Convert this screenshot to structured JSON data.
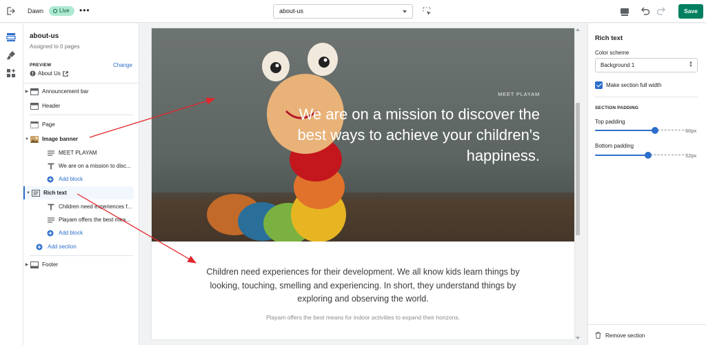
{
  "topbar": {
    "theme_name": "Dawn",
    "status_badge": "Live",
    "more_label": "•••",
    "page_select_value": "about-us",
    "save_label": "Save"
  },
  "left_panel": {
    "template_name": "about-us",
    "assigned": "Assigned to 0 pages",
    "preview_header": "PREVIEW",
    "change_link": "Change",
    "preview_page": "About Us",
    "sections": {
      "announcement_bar": "Announcement bar",
      "header": "Header",
      "page": "Page",
      "image_banner": "Image banner",
      "image_banner_blocks": [
        "MEET PLAYAM",
        "We are on a mission to disc..."
      ],
      "rich_text": "Rich text",
      "rich_text_blocks": [
        "Children need experiences f...",
        "Playam offers the best mea..."
      ],
      "add_block": "Add block",
      "add_section": "Add section",
      "footer": "Footer"
    }
  },
  "preview": {
    "banner_eyebrow": "MEET PLAYAM",
    "banner_headline": "We are on a mission to discover the best ways to achieve your children's happiness.",
    "rich_text_paragraph": "Children need experiences for their development. We all know kids learn things by looking, touching, smelling and experiencing. In short, they understand things by exploring and observing the world.",
    "rich_text_caption": "Playam offers the best means for indoor activities to expand their horizons."
  },
  "right_panel": {
    "title": "Rich text",
    "color_scheme_label": "Color scheme",
    "color_scheme_value": "Background 1",
    "full_width_label": "Make section full width",
    "full_width_checked": true,
    "section_padding_header": "SECTION PADDING",
    "top_padding_label": "Top padding",
    "top_padding_value": "60px",
    "top_padding_fraction": 0.6,
    "bottom_padding_label": "Bottom padding",
    "bottom_padding_value": "52px",
    "bottom_padding_fraction": 0.52,
    "remove_section": "Remove section"
  },
  "colors": {
    "accent": "#2c6ecb",
    "save": "#008060",
    "live_badge_bg": "#aee9d1",
    "annotation_arrow": "#e3262b"
  },
  "icons": {
    "exit": "exit-icon",
    "inspector": "inspector-icon",
    "device": "desktop-icon",
    "undo": "undo-icon",
    "redo": "redo-icon",
    "sections_rail": "sections-icon",
    "theme_settings_rail": "brush-icon",
    "apps_rail": "apps-icon",
    "remove": "trash-icon"
  }
}
